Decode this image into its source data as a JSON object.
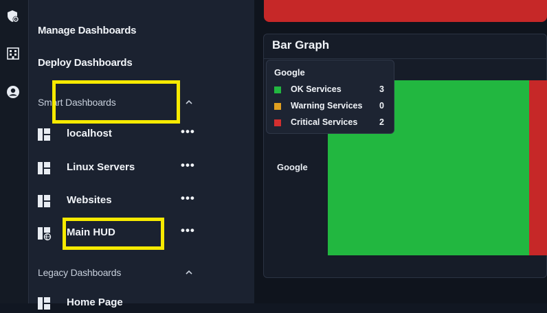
{
  "rail": {
    "icons": [
      "shield-gear-icon",
      "building-icon",
      "user-circle-icon"
    ]
  },
  "sidebar": {
    "manage_dashboards": "Manage Dashboards",
    "deploy_dashboards": "Deploy Dashboards",
    "smart_section": "Smart Dashboards",
    "smart_items": [
      {
        "label": "localhost",
        "more": "•••",
        "icon": "dashboard-icon"
      },
      {
        "label": "Linux Servers",
        "more": "•••",
        "icon": "dashboard-icon"
      },
      {
        "label": "Websites",
        "more": "•••",
        "icon": "dashboard-icon"
      },
      {
        "label": "Main HUD",
        "more": "•••",
        "icon": "dashboard-globe-icon"
      }
    ],
    "legacy_section": "Legacy Dashboards",
    "legacy_items": [
      {
        "label": "Home Page",
        "icon": "dashboard-icon"
      }
    ]
  },
  "panel": {
    "title": "Bar Graph",
    "category": "Google",
    "tooltip": {
      "title": "Google",
      "rows": [
        {
          "name": "OK Services",
          "value": "3",
          "color": "#22b740"
        },
        {
          "name": "Warning Services",
          "value": "0",
          "color": "#e0a020"
        },
        {
          "name": "Critical Services",
          "value": "2",
          "color": "#d32f2f"
        }
      ]
    }
  },
  "chart_data": {
    "type": "bar",
    "categories": [
      "Google"
    ],
    "series": [
      {
        "name": "OK Services",
        "values": [
          3
        ]
      },
      {
        "name": "Warning Services",
        "values": [
          0
        ]
      },
      {
        "name": "Critical Services",
        "values": [
          2
        ]
      }
    ],
    "title": "Bar Graph"
  },
  "colors": {
    "highlight": "#f7ea00",
    "ok": "#22b740",
    "critical": "#c62828",
    "warning": "#e0a020"
  }
}
